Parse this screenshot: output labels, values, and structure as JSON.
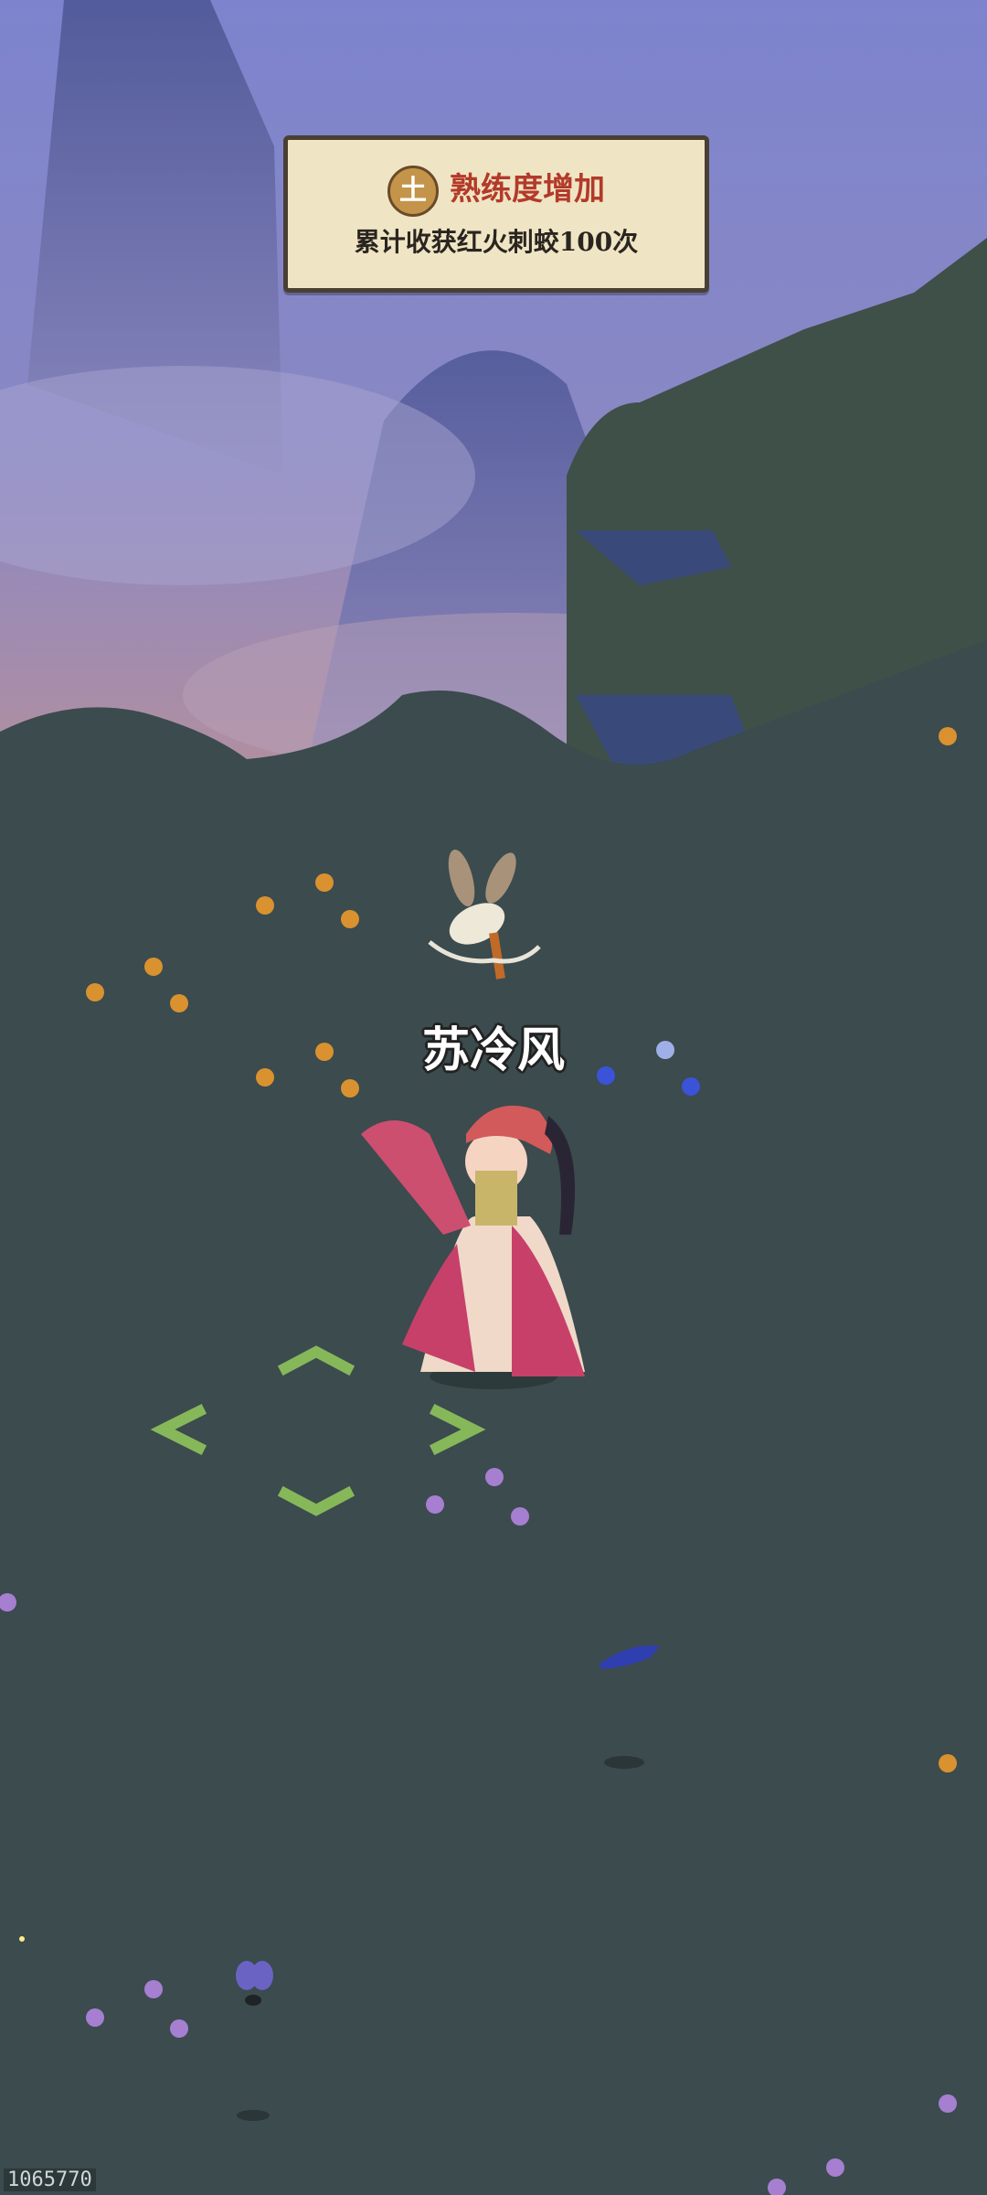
{
  "notification": {
    "badge": "土",
    "title": "熟练度增加",
    "message": "累计收获红火刺蛟100次"
  },
  "character": {
    "name": "苏冷风"
  },
  "build_id": "1065770",
  "colors": {
    "sky_top": "#7f86cf",
    "sky_bottom": "#b38f9a",
    "grass": "#3b4b4e",
    "dpad": "#86b85a",
    "toast_bg": "#efe5c4",
    "toast_title": "#b33a2a"
  },
  "icons": {
    "dpad": [
      "arrow-up-icon",
      "arrow-left-icon",
      "arrow-right-icon",
      "arrow-down-icon"
    ]
  }
}
